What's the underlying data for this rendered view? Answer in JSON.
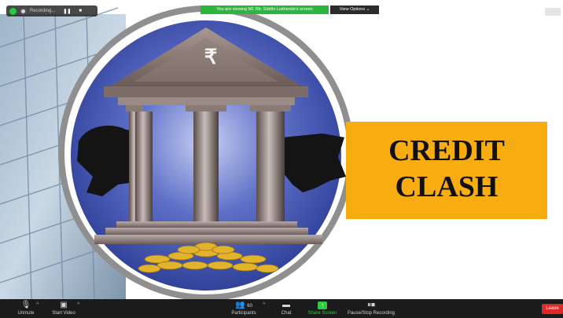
{
  "recording": {
    "label": "Recording...",
    "pause_label": "❚❚",
    "stop_label": "■"
  },
  "share_banner": {
    "text": "You are viewing M1 Rtr. Siddhi Lokhande's screen",
    "view_options": "View Options ⌄"
  },
  "slide": {
    "title_line1": "CREDIT",
    "title_line2": "CLASH",
    "rupee_symbol": "₹"
  },
  "toolbar": {
    "unmute": "Unmute",
    "start_video": "Start Video",
    "participants": "Participants",
    "participants_count": "60",
    "chat": "Chat",
    "share_screen": "Share Screen",
    "pause_stop_recording": "Pause/Stop Recording",
    "leave": "Leave"
  },
  "colors": {
    "banner_green": "#2db53e",
    "accent_orange": "#f7ad11",
    "leave_red": "#e02828",
    "circle_blue": "#3a4fa8"
  }
}
